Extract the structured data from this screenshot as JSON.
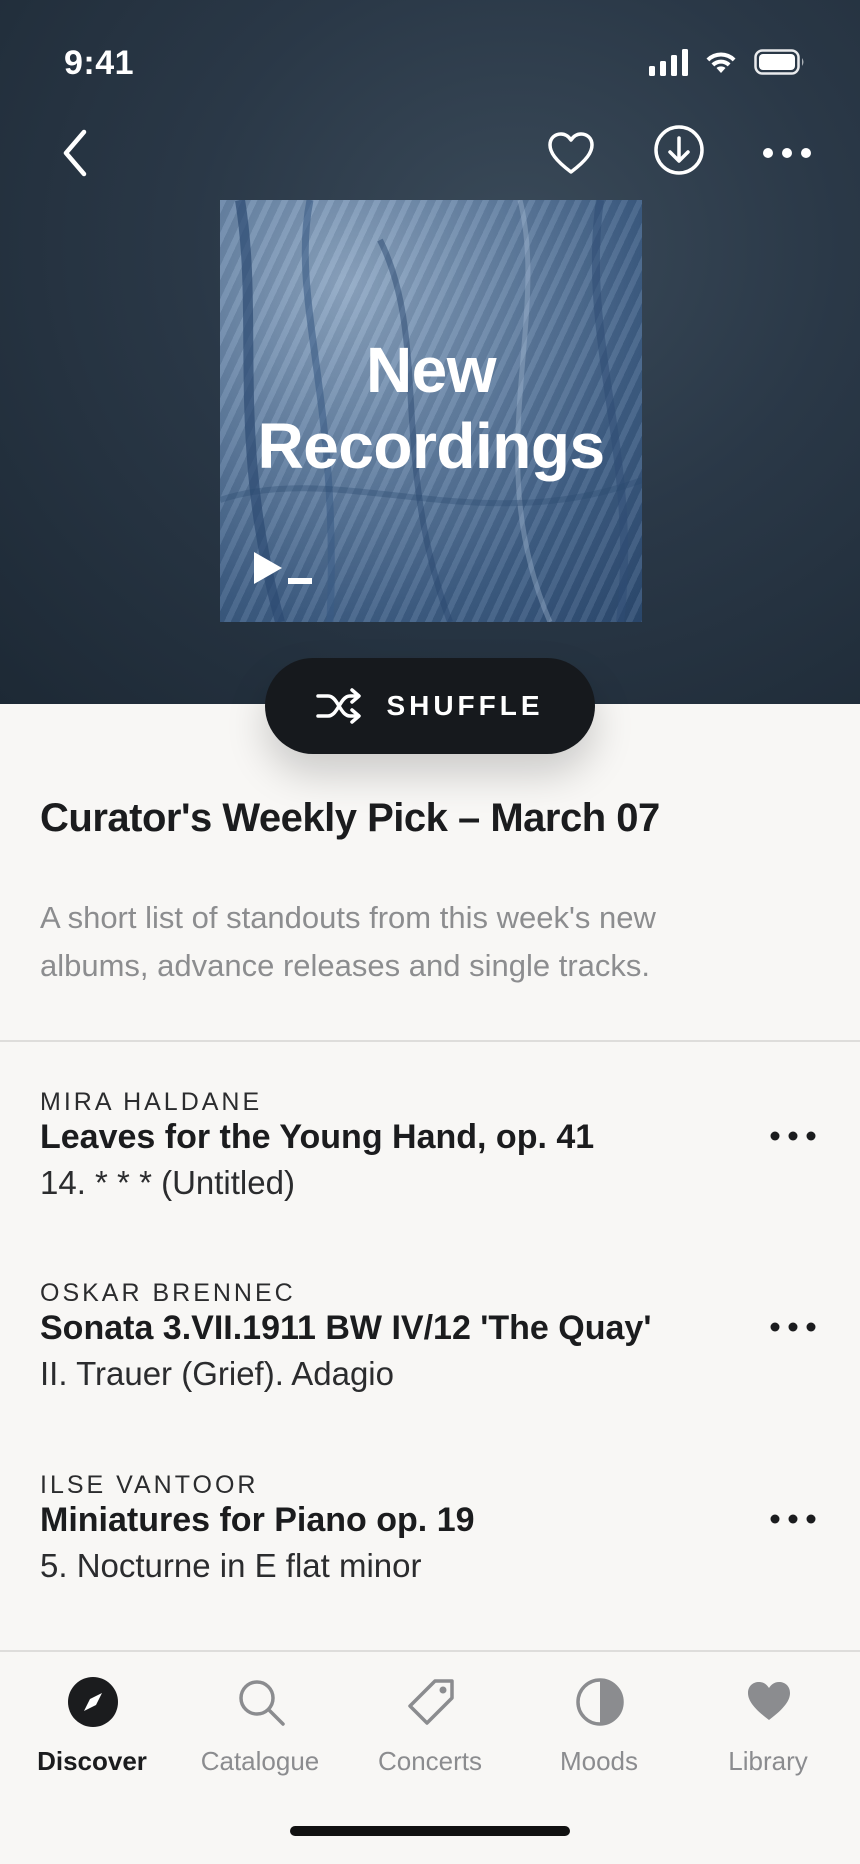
{
  "status_bar": {
    "time": "9:41"
  },
  "header": {
    "actions": {
      "back_icon": "chevron-left-icon",
      "favorite_icon": "heart-outline-icon",
      "download_icon": "download-circle-icon",
      "more_icon": "more-horizontal-icon"
    }
  },
  "artwork": {
    "title_line1": "New",
    "title_line2": "Recordings",
    "logo_icon": "play-cursor-logo"
  },
  "shuffle": {
    "label": "SHUFFLE",
    "icon": "shuffle-icon"
  },
  "playlist": {
    "title": "Curator's Weekly Pick – March 07",
    "description": "A short list of standouts from this week's new albums, advance releases and single tracks."
  },
  "tracks": [
    {
      "artist": "MIRA HALDANE",
      "work": "Leaves for the Young Hand, op. 41",
      "movement": "14. * * * (Untitled)"
    },
    {
      "artist": "OSKAR BRENNEC",
      "work": "Sonata 3.VII.1911 BW IV/12 'The Quay'",
      "movement": "II. Trauer (Grief). Adagio"
    },
    {
      "artist": "ILSE VANTOOR",
      "work": "Miniatures for Piano op. 19",
      "movement": "5. Nocturne in E flat minor"
    }
  ],
  "tabbar": {
    "tabs": [
      {
        "label": "Discover",
        "icon": "compass-icon",
        "active": true
      },
      {
        "label": "Catalogue",
        "icon": "search-icon",
        "active": false
      },
      {
        "label": "Concerts",
        "icon": "ticket-icon",
        "active": false
      },
      {
        "label": "Moods",
        "icon": "half-circle-icon",
        "active": false
      },
      {
        "label": "Library",
        "icon": "heart-filled-icon",
        "active": false
      }
    ]
  },
  "colors": {
    "hero_bg": "#2a3847",
    "shuffle_bg": "#16191d",
    "text_primary": "#1b1c1e",
    "text_secondary": "#8c8d8f",
    "tab_inactive": "#8b8c8f"
  }
}
